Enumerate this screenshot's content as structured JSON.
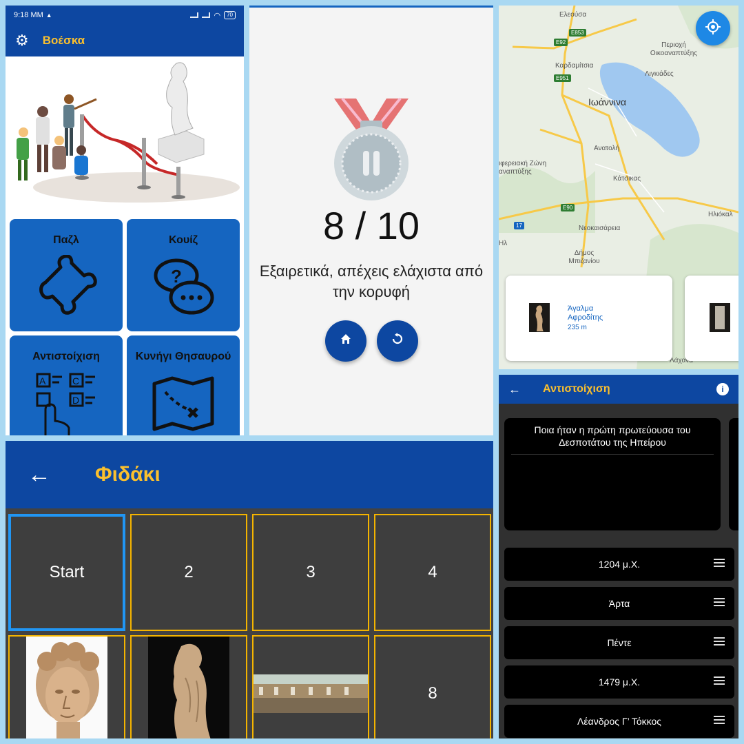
{
  "home": {
    "status": {
      "time": "9:18 ΜΜ",
      "battery": "70"
    },
    "app_title": "Βοέσκα",
    "tiles": [
      {
        "label": "Παζλ",
        "icon": "puzzle-icon"
      },
      {
        "label": "Κουίζ",
        "icon": "chat-question-icon"
      },
      {
        "label": "Αντιστοίχιση",
        "icon": "match-abcd-icon"
      },
      {
        "label": "Κυνήγι Θησαυρού",
        "icon": "treasure-map-icon"
      }
    ],
    "colors": {
      "appbar": "#0d47a1",
      "tile": "#1565c0",
      "title": "#fbc02d"
    }
  },
  "score": {
    "value": "8 / 10",
    "message": "Εξαιρετικά, απέχεις ελάχιστα από την κορυφή",
    "buttons": [
      {
        "icon": "home-icon"
      },
      {
        "icon": "replay-icon"
      }
    ]
  },
  "map": {
    "labels": {
      "eleousa": "Ελεούσα",
      "perioxi": "Περιοχή Οικοαναπτύξης",
      "kardamitsia": "Καρδαμίτσια",
      "ligkiades": "Λιγκιάδες",
      "ioannina": "Ιωάννινα",
      "anatoli": "Ανατολή",
      "zoni": "ιφερειακή Ζώνη αναπτύξης",
      "katsikas": "Κάτσικας",
      "neokaisareia": "Νεοκαισάρεια",
      "dimos": "Δήμος Μπιζανίου",
      "iliokali": "Ηλιόκαλ",
      "ili": "Ηλ",
      "laxana": "Λάχανά"
    },
    "road_shields": [
      "E853",
      "E92",
      "E951",
      "E90",
      "17"
    ],
    "card": {
      "title": "Άγαλμα Αφροδίτης",
      "distance": "235 m"
    }
  },
  "board": {
    "title": "Φιδάκι",
    "cells": [
      "Start",
      "2",
      "3",
      "4",
      "",
      "",
      "",
      "8"
    ]
  },
  "matching": {
    "title": "Αντιστοίχιση",
    "question": "Ποια ήταν η πρώτη πρωτεύουσα του Δεσποτάτου της Ηπείρου",
    "answers": [
      "1204 μ.Χ.",
      "Άρτα",
      "Πέντε",
      "1479 μ.Χ.",
      "Λέανδρος Γ’ Τόκκος"
    ]
  }
}
